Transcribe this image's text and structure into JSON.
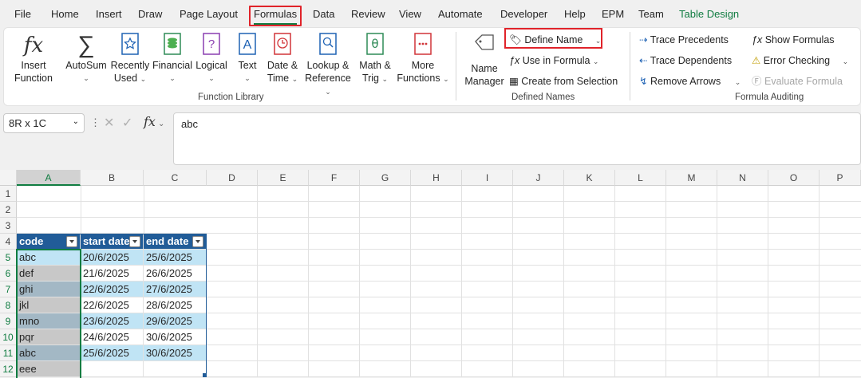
{
  "tabs": [
    "File",
    "Home",
    "Insert",
    "Draw",
    "Page Layout",
    "Formulas",
    "Data",
    "Review",
    "View",
    "Automate",
    "Developer",
    "Help",
    "EPM",
    "Team",
    "Table Design"
  ],
  "function_library": {
    "group_label": "Function Library",
    "insert_function": [
      "Insert",
      "Function"
    ],
    "autosum": "AutoSum",
    "recently_used": [
      "Recently",
      "Used"
    ],
    "financial": "Financial",
    "logical": "Logical",
    "text": "Text",
    "date_time": [
      "Date &",
      "Time"
    ],
    "lookup": [
      "Lookup &",
      "Reference"
    ],
    "math": [
      "Math &",
      "Trig"
    ],
    "more": [
      "More",
      "Functions"
    ]
  },
  "defined_names": {
    "group_label": "Defined Names",
    "name_manager": [
      "Name",
      "Manager"
    ],
    "define_name": "Define Name",
    "use_in_formula": "Use in Formula",
    "create_from_selection": "Create from Selection"
  },
  "formula_auditing": {
    "group_label": "Formula Auditing",
    "trace_precedents": "Trace Precedents",
    "trace_dependents": "Trace Dependents",
    "remove_arrows": "Remove Arrows",
    "show_formulas": "Show Formulas",
    "error_checking": "Error Checking",
    "evaluate_formula": "Evaluate Formula"
  },
  "name_box": "8R x 1C",
  "fx_label": "fx",
  "formula_value": "abc",
  "columns": [
    "A",
    "B",
    "C",
    "D",
    "E",
    "F",
    "G",
    "H",
    "I",
    "J",
    "K",
    "L",
    "M",
    "N",
    "O",
    "P"
  ],
  "rows": [
    "1",
    "2",
    "3",
    "4",
    "5",
    "6",
    "7",
    "8",
    "9",
    "10",
    "11",
    "12"
  ],
  "table": {
    "headers": [
      "code",
      "start date",
      "end date"
    ],
    "rows": [
      [
        "abc",
        "20/6/2025",
        "25/6/2025"
      ],
      [
        "def",
        "21/6/2025",
        "26/6/2025"
      ],
      [
        "ghi",
        "22/6/2025",
        "27/6/2025"
      ],
      [
        "jkl",
        "22/6/2025",
        "28/6/2025"
      ],
      [
        "mno",
        "23/6/2025",
        "29/6/2025"
      ],
      [
        "pqr",
        "24/6/2025",
        "30/6/2025"
      ],
      [
        "abc",
        "25/6/2025",
        "30/6/2025"
      ],
      [
        "eee",
        "",
        ""
      ]
    ]
  },
  "colors": {
    "accent": "#107c41",
    "table_header": "#215c98",
    "band": "#c0e4f5",
    "highlight": "#e0232a"
  }
}
